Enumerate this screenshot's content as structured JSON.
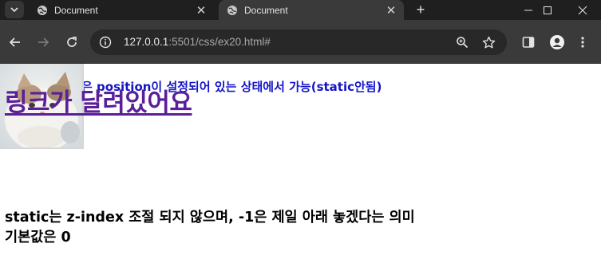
{
  "browser": {
    "tabs": [
      {
        "title": "Document",
        "active": false
      },
      {
        "title": "Document",
        "active": true
      }
    ],
    "url_host": "127.0.0.1",
    "url_rest": ":5501/css/ex20.html#"
  },
  "page": {
    "blue_text": "z-index는 position이 설정되어 있는 상태에서 가능(static안됨)",
    "blue_text_visible": "은 position이 설정되어 있는 상태에서 가능(static안됨)",
    "link_text": "링크가 달려있어요",
    "bottom_line1": "static는 z-index 조절 되지 않으며, -1은 제일 아래 놓겠다는 의미",
    "bottom_line2": "기본값은 0",
    "image_icon": "cat-photo"
  },
  "colors": {
    "tabbar": "#1f1f1f",
    "toolbar": "#3a3a3a",
    "omnibox": "#282828",
    "blue_text": "#1414c8",
    "link": "#5a1f99"
  }
}
